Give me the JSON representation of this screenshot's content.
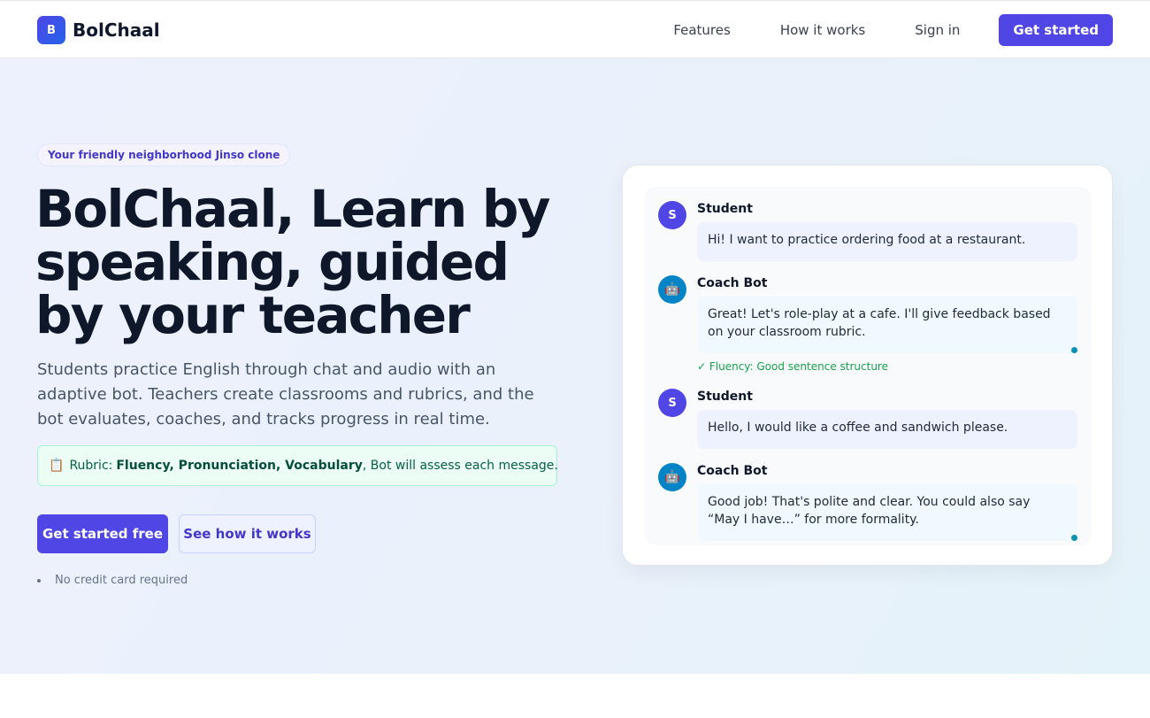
{
  "brand": {
    "logo_letter": "B",
    "name": "BolChaal",
    "accent": "#4f46e5"
  },
  "nav": {
    "links": [
      "Features",
      "How it works",
      "Sign in"
    ],
    "cta": "Get started"
  },
  "hero": {
    "tagline": "Your friendly neighborhood Jinso clone",
    "headline": "BolChaal, Learn by speaking, guided by your teacher",
    "description": "Students practice English through chat and audio with an adaptive bot. Teachers create classrooms and rubrics, and the bot evaluates, coaches, and tracks progress in real time.",
    "rubric": {
      "icon": "📋",
      "prefix": "Rubric:",
      "criteria": "Fluency, Pronunciation, Vocabulary",
      "suffix": ", Bot will assess each message."
    },
    "primary_button": "Get started free",
    "secondary_button": "See how it works",
    "note": "No credit card required"
  },
  "chat": {
    "messages": [
      {
        "speaker": "Student",
        "avatar": "S",
        "role": "student",
        "text": "Hi! I want to practice ordering food at a restaurant."
      },
      {
        "speaker": "Coach Bot",
        "avatar": "🤖",
        "role": "bot",
        "text": "Great! Let's role-play at a cafe. I'll give feedback based on your classroom rubric."
      },
      {
        "speaker": "Student",
        "avatar": "S",
        "role": "student",
        "text": "Hello, I would like a coffee and sandwich please."
      },
      {
        "speaker": "Coach Bot",
        "avatar": "🤖",
        "role": "bot",
        "text": "Good job! That's polite and clear. You could also say “May I have…” for more formality."
      }
    ],
    "feedback": "✓ Fluency: Good sentence structure"
  }
}
